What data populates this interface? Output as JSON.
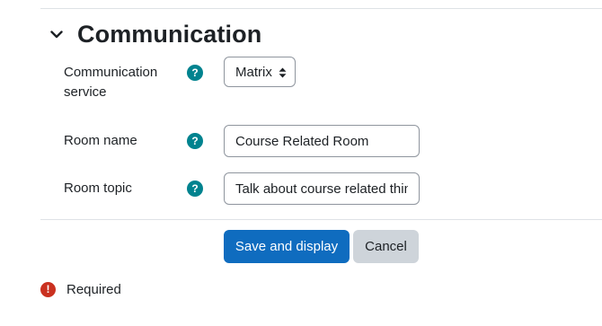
{
  "section": {
    "title": "Communication",
    "toggle_icon": "chevron-down-icon"
  },
  "fields": {
    "service": {
      "label_line1": "Communication",
      "label_line2": "service",
      "help_icon": "?",
      "selected": "Matrix"
    },
    "room_name": {
      "label": "Room name",
      "help_icon": "?",
      "value": "Course Related Room"
    },
    "room_topic": {
      "label": "Room topic",
      "help_icon": "?",
      "value": "Talk about course related things"
    }
  },
  "buttons": {
    "save_label": "Save and display",
    "cancel_label": "Cancel"
  },
  "required": {
    "icon": "!",
    "label": "Required"
  },
  "colors": {
    "primary": "#0f6cbf",
    "help": "#00838f",
    "required": "#ca3120",
    "secondary": "#ced4da"
  }
}
